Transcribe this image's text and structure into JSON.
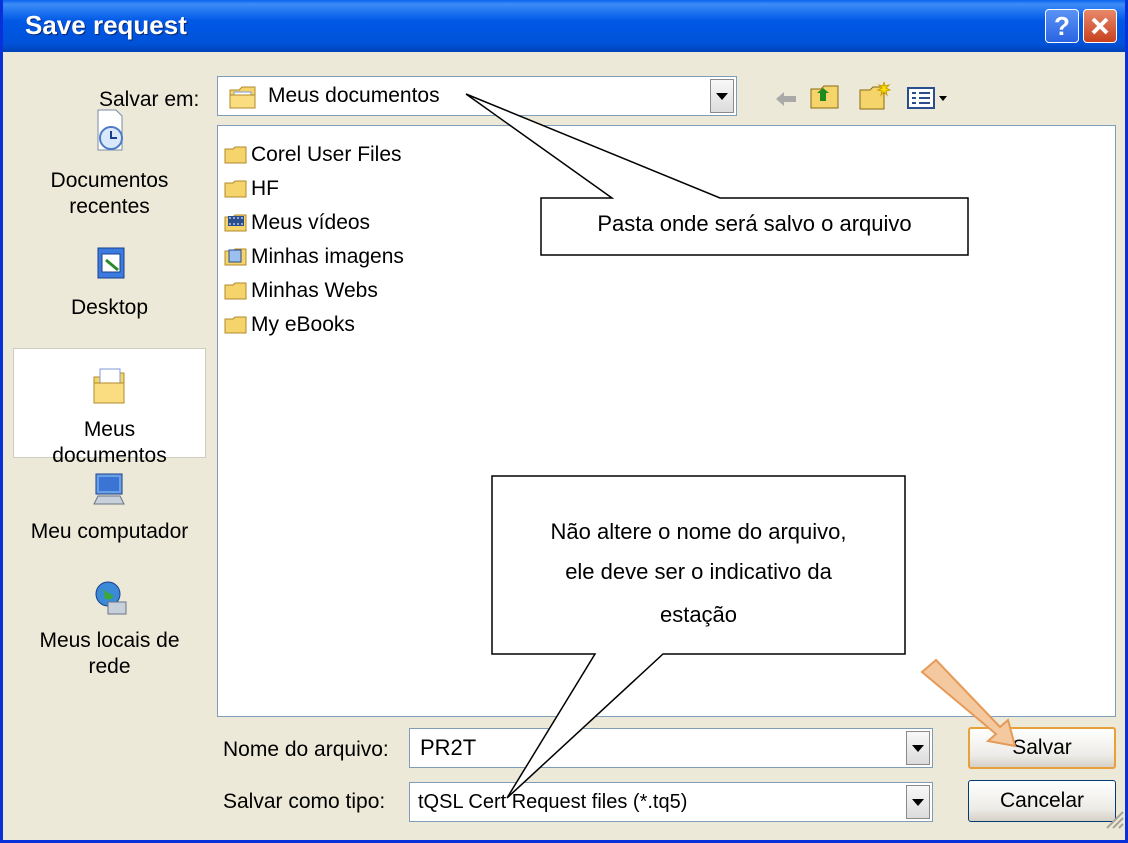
{
  "window": {
    "title": "Save request"
  },
  "toolbar": {
    "save_in_label": "Salvar em:",
    "current_folder": "Meus documentos"
  },
  "places": [
    {
      "label": "Documentos recentes",
      "icon": "recent-documents-icon"
    },
    {
      "label": "Desktop",
      "icon": "desktop-icon"
    },
    {
      "label": "Meus documentos",
      "icon": "my-documents-icon"
    },
    {
      "label": "Meu computador",
      "icon": "my-computer-icon"
    },
    {
      "label": "Meus locais de rede",
      "icon": "network-places-icon"
    }
  ],
  "files": [
    {
      "name": "Corel User Files",
      "icon": "folder-icon"
    },
    {
      "name": "HF",
      "icon": "folder-icon"
    },
    {
      "name": "Meus vídeos",
      "icon": "video-folder-icon"
    },
    {
      "name": "Minhas imagens",
      "icon": "pictures-folder-icon"
    },
    {
      "name": "Minhas Webs",
      "icon": "folder-icon"
    },
    {
      "name": "My eBooks",
      "icon": "folder-icon"
    }
  ],
  "filename": {
    "label": "Nome do arquivo:",
    "value": "PR2T"
  },
  "filetype": {
    "label": "Salvar como tipo:",
    "value": "tQSL Cert Request files (*.tq5)"
  },
  "buttons": {
    "save": "Salvar",
    "cancel": "Cancelar"
  },
  "callouts": {
    "folder": "Pasta onde será salvo o arquivo",
    "filename_line1": "Não altere o nome do arquivo,",
    "filename_line2": "ele deve ser o indicativo da",
    "filename_line3": "estação"
  },
  "colors": {
    "titlebar": "#0055E5",
    "dialog": "#ECE9D8",
    "folder": "#F5D46C",
    "arrow": "#F5C9A0"
  }
}
